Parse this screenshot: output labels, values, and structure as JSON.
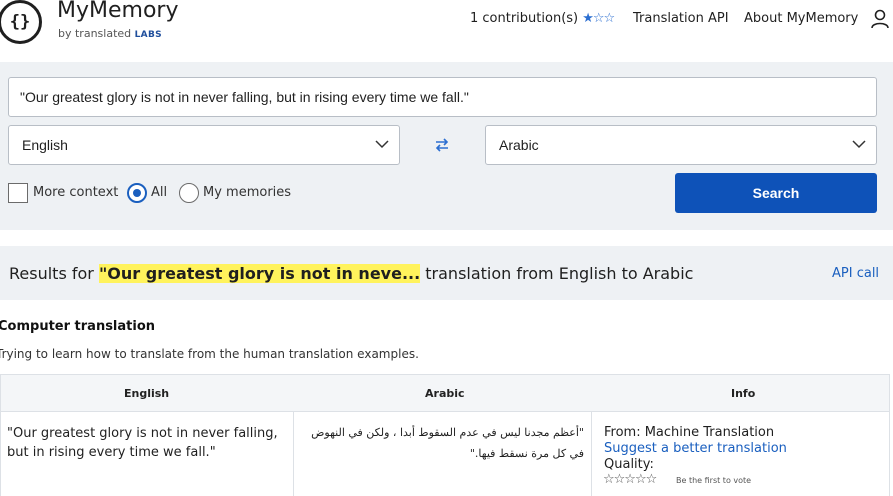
{
  "header": {
    "logo_glyph": "{}",
    "app_title": "MyMemory",
    "byline": "by translated",
    "byline_labs": "LABS",
    "contributions": "1 contribution(s)",
    "contribution_stars": "★☆☆",
    "nav_items": [
      "Translation API",
      "About MyMemory"
    ],
    "user_icon": "user-icon"
  },
  "search": {
    "query": "\"Our greatest glory is not in never falling, but in rising every time we fall.\"",
    "source_lang": "English",
    "target_lang": "Arabic",
    "swap_icon": "swap-arrows-icon",
    "more_context_label": "More context",
    "radio_all_label": "All",
    "radio_memories_label": "My memories",
    "selected_scope": "All",
    "button_label": "Search"
  },
  "results": {
    "prefix": "Results for ",
    "highlight": "\"Our greatest glory is not in neve...",
    "suffix": " translation from English to Arabic",
    "api_call": "API call"
  },
  "computer_translation": {
    "title": "Computer translation",
    "subtitle": "Trying to learn how to translate from the human translation examples."
  },
  "table": {
    "headers": [
      "English",
      "Arabic",
      "Info"
    ],
    "rows": [
      {
        "english": "\"Our greatest glory is not in never falling, but in rising every time we fall.\"",
        "arabic": "\"أعظم مجدنا ليس في عدم السقوط أبدا ، ولكن في النهوض في كل مرة نسقط فيها.\"",
        "from": "From: Machine Translation",
        "suggest": "Suggest a better translation",
        "quality": "Quality:",
        "quality_stars": "☆☆☆☆☆",
        "vote_text": "Be the first to vote"
      }
    ]
  },
  "colors": {
    "accent": "#0e52b8",
    "link": "#1a5fbf",
    "highlight": "#fff35c",
    "panel_bg": "#eef1f4"
  }
}
